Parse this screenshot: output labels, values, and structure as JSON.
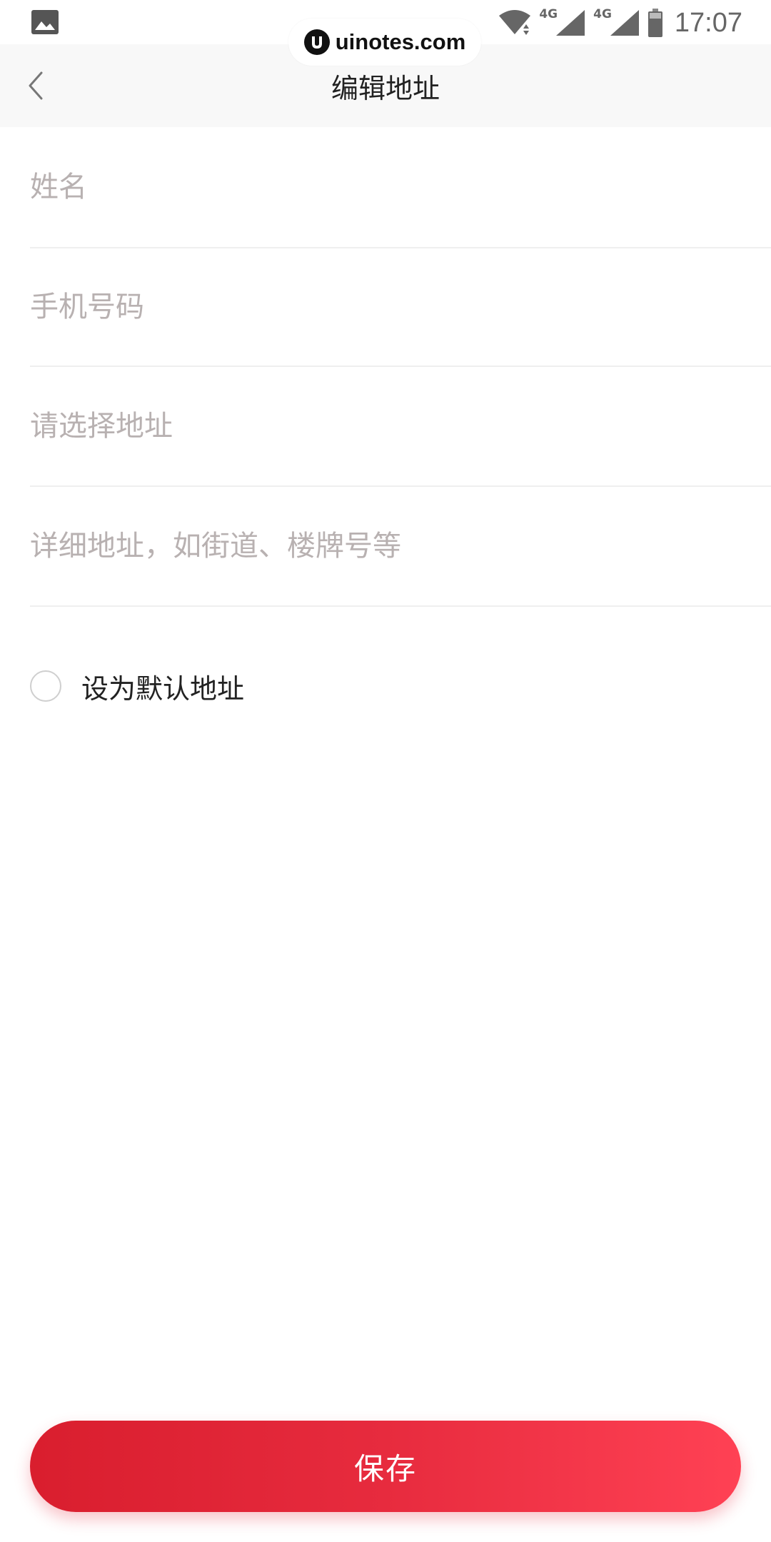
{
  "status_bar": {
    "time": "17:07",
    "network_labels": [
      "4G",
      "4G"
    ],
    "icons": [
      "gallery-icon",
      "wifi-icon",
      "signal-icon",
      "signal-icon",
      "battery-icon"
    ]
  },
  "watermark": {
    "text": "uinotes.com"
  },
  "header": {
    "title": "编辑地址",
    "back_icon": "chevron-left-icon"
  },
  "form": {
    "name": {
      "value": "",
      "placeholder": "姓名"
    },
    "phone": {
      "value": "",
      "placeholder": "手机号码"
    },
    "region": {
      "value": "",
      "placeholder": "请选择地址"
    },
    "detail": {
      "value": "",
      "placeholder": "详细地址，如街道、楼牌号等"
    },
    "default_checkbox": {
      "label": "设为默认地址",
      "checked": false
    }
  },
  "actions": {
    "save_label": "保存"
  },
  "colors": {
    "accent_start": "#d91e2e",
    "accent_end": "#ff4154",
    "placeholder": "#b8b1b1",
    "nav_background": "#f8f8f8"
  }
}
